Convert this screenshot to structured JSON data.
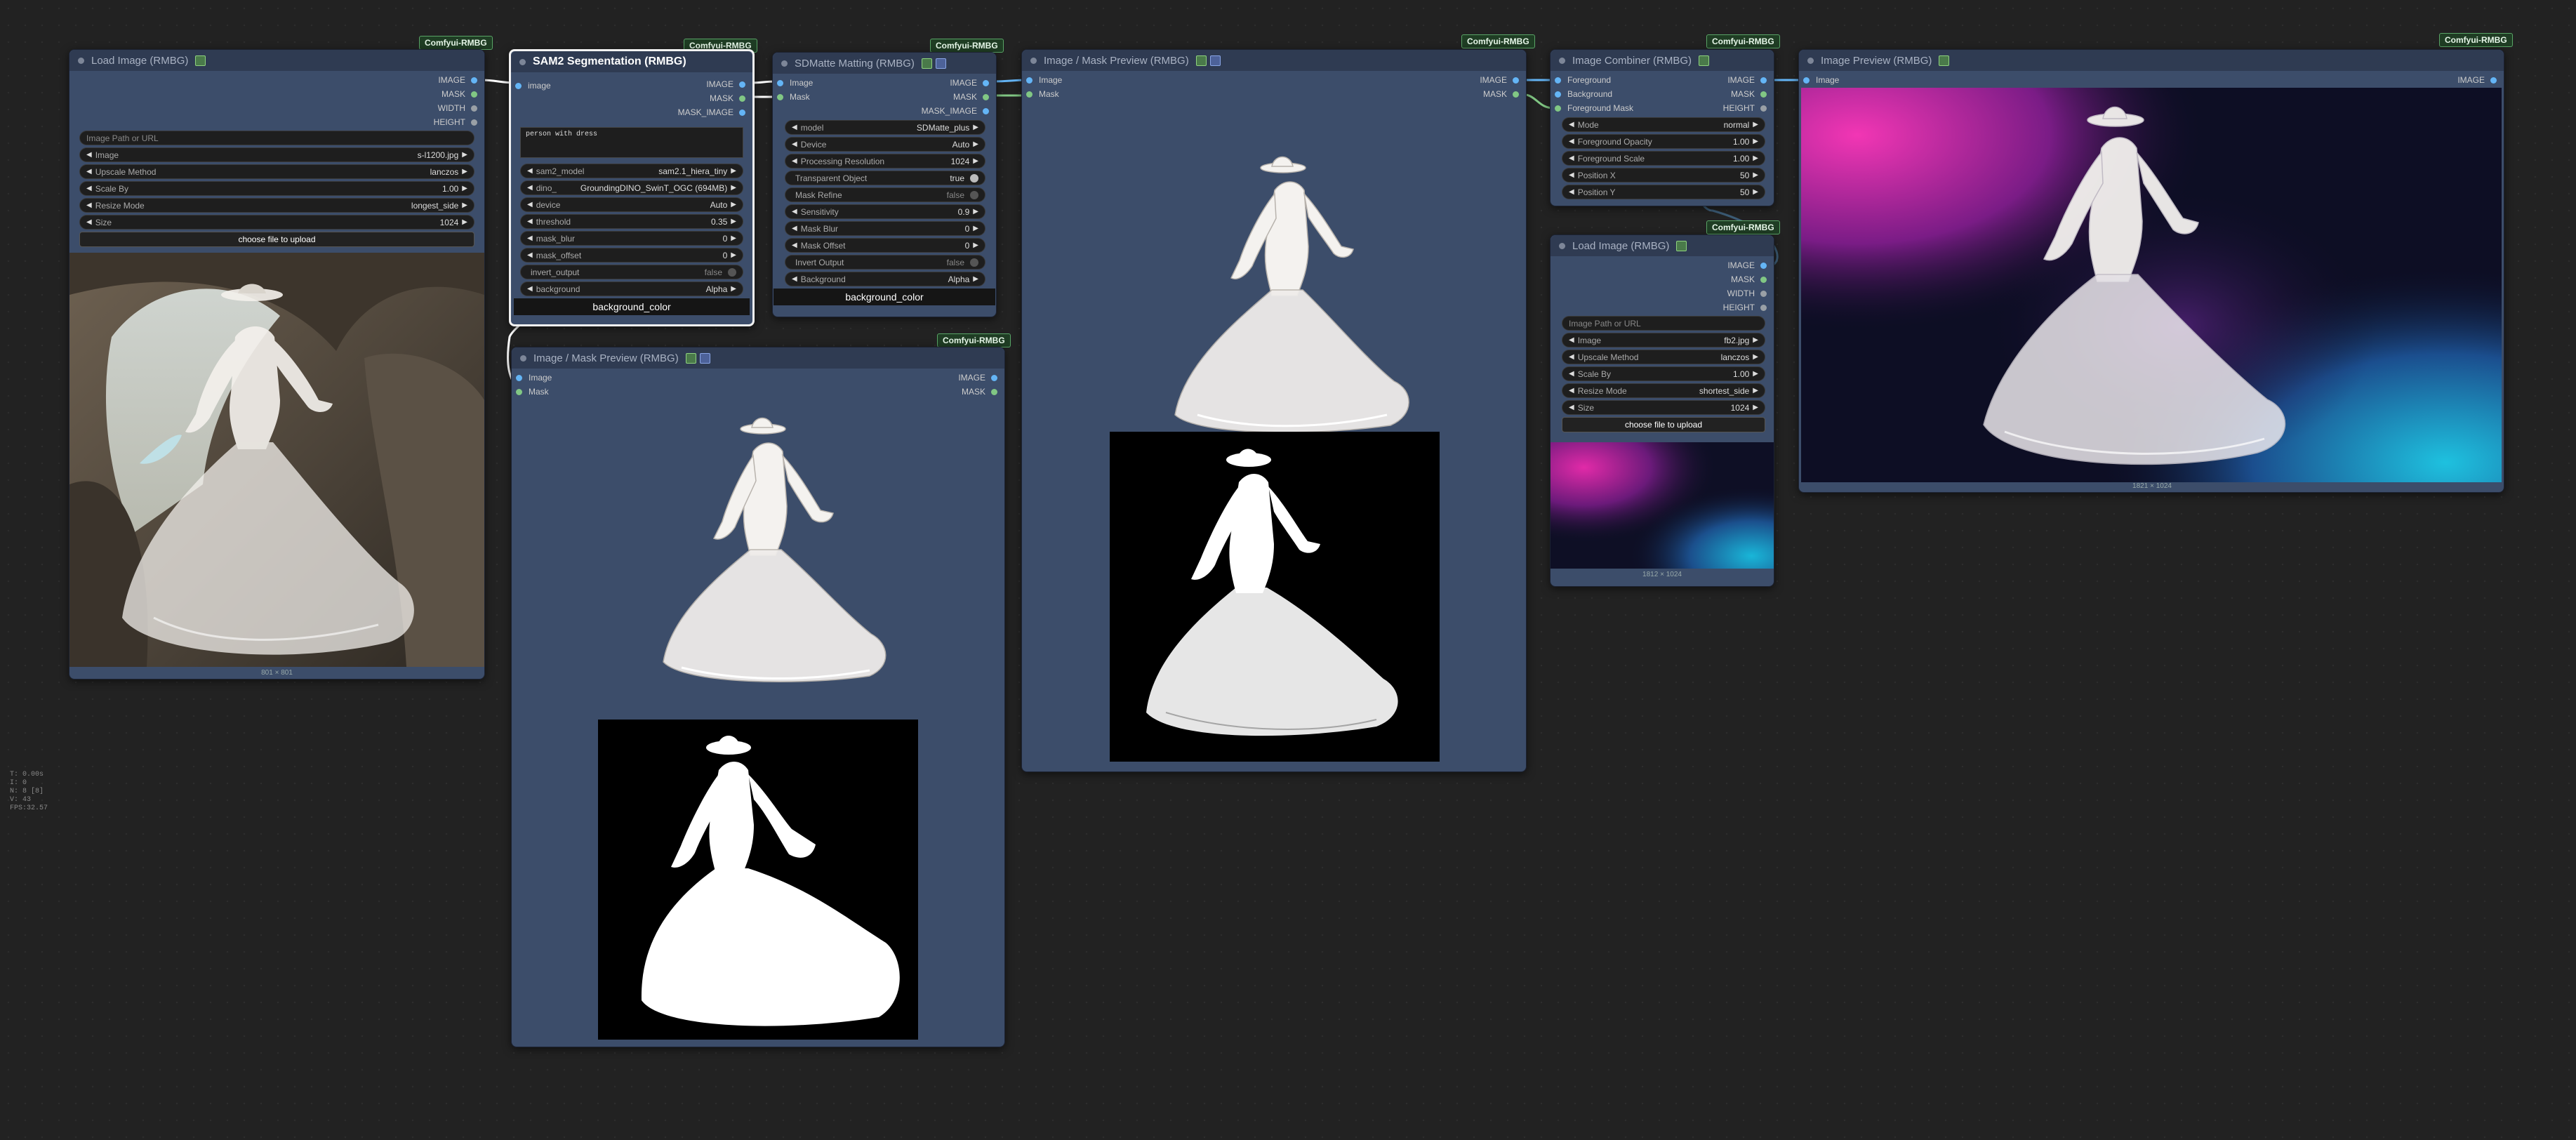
{
  "badge": "Comfyui-RMBG",
  "nodes": {
    "load1": {
      "title": "Load Image (RMBG)",
      "outputs": [
        "IMAGE",
        "MASK",
        "WIDTH",
        "HEIGHT"
      ],
      "path_placeholder": "Image Path or URL",
      "widgets": [
        {
          "name": "Image",
          "value": "s-l1200.jpg"
        },
        {
          "name": "Upscale Method",
          "value": "lanczos"
        },
        {
          "name": "Scale By",
          "value": "1.00"
        },
        {
          "name": "Resize Mode",
          "value": "longest_side"
        },
        {
          "name": "Size",
          "value": "1024"
        }
      ],
      "upload_label": "choose file to upload",
      "dims": "801 × 801"
    },
    "sam2": {
      "title": "SAM2 Segmentation (RMBG)",
      "input": "image",
      "outputs": [
        "IMAGE",
        "MASK",
        "MASK_IMAGE"
      ],
      "prompt": "person with dress",
      "widgets": [
        {
          "name": "sam2_model",
          "value": "sam2.1_hiera_tiny"
        },
        {
          "name": "dino_",
          "value": "GroundingDINO_SwinT_OGC (694MB)"
        },
        {
          "name": "device",
          "value": "Auto"
        },
        {
          "name": "threshold",
          "value": "0.35"
        },
        {
          "name": "mask_blur",
          "value": "0"
        },
        {
          "name": "mask_offset",
          "value": "0"
        },
        {
          "name": "invert_output",
          "value": "false"
        },
        {
          "name": "background",
          "value": "Alpha"
        }
      ],
      "bg_color": "background_color"
    },
    "sdm": {
      "title": "SDMatte Matting (RMBG)",
      "inputs": [
        "Image",
        "Mask"
      ],
      "outputs": [
        "IMAGE",
        "MASK",
        "MASK_IMAGE"
      ],
      "widgets": [
        {
          "name": "model",
          "value": "SDMatte_plus"
        },
        {
          "name": "Device",
          "value": "Auto"
        },
        {
          "name": "Processing Resolution",
          "value": "1024"
        },
        {
          "name": "Transparent Object",
          "value": "true"
        },
        {
          "name": "Mask Refine",
          "value": "false"
        },
        {
          "name": "Sensitivity",
          "value": "0.9"
        },
        {
          "name": "Mask Blur",
          "value": "0"
        },
        {
          "name": "Mask Offset",
          "value": "0"
        },
        {
          "name": "Invert Output",
          "value": "false"
        },
        {
          "name": "Background",
          "value": "Alpha"
        }
      ],
      "bg_color": "background_color"
    },
    "prev1": {
      "title": "Image / Mask Preview (RMBG)",
      "inputs": [
        "Image",
        "Mask"
      ],
      "outputs": [
        "IMAGE",
        "MASK"
      ]
    },
    "prev2": {
      "title": "Image / Mask Preview (RMBG)",
      "inputs": [
        "Image",
        "Mask"
      ],
      "outputs": [
        "IMAGE",
        "MASK"
      ]
    },
    "comb": {
      "title": "Image Combiner (RMBG)",
      "inputs": [
        "Foreground",
        "Background",
        "Foreground Mask"
      ],
      "outputs": [
        "IMAGE",
        "MASK",
        "HEIGHT"
      ],
      "widgets": [
        {
          "name": "Mode",
          "value": "normal"
        },
        {
          "name": "Foreground Opacity",
          "value": "1.00"
        },
        {
          "name": "Foreground Scale",
          "value": "1.00"
        },
        {
          "name": "Position X",
          "value": "50"
        },
        {
          "name": "Position Y",
          "value": "50"
        }
      ]
    },
    "load2": {
      "title": "Load Image (RMBG)",
      "outputs": [
        "IMAGE",
        "MASK",
        "WIDTH",
        "HEIGHT"
      ],
      "path_placeholder": "Image Path or URL",
      "widgets": [
        {
          "name": "Image",
          "value": "fb2.jpg"
        },
        {
          "name": "Upscale Method",
          "value": "lanczos"
        },
        {
          "name": "Scale By",
          "value": "1.00"
        },
        {
          "name": "Resize Mode",
          "value": "shortest_side"
        },
        {
          "name": "Size",
          "value": "1024"
        }
      ],
      "upload_label": "choose file to upload",
      "dims": "1812 × 1024"
    },
    "final": {
      "title": "Image Preview (RMBG)",
      "input": "Image",
      "output": "IMAGE",
      "dims": "1821 × 1024"
    }
  },
  "stats": [
    "T: 0.00s",
    "I: 0",
    "N: 8 [8]",
    "V: 43",
    "FPS:32.57"
  ],
  "colors": {
    "image_link": "#64b5f6",
    "mask_link": "#81c784",
    "badge_bg": "#1f3d24",
    "node_bg": "#3c4d6a"
  }
}
